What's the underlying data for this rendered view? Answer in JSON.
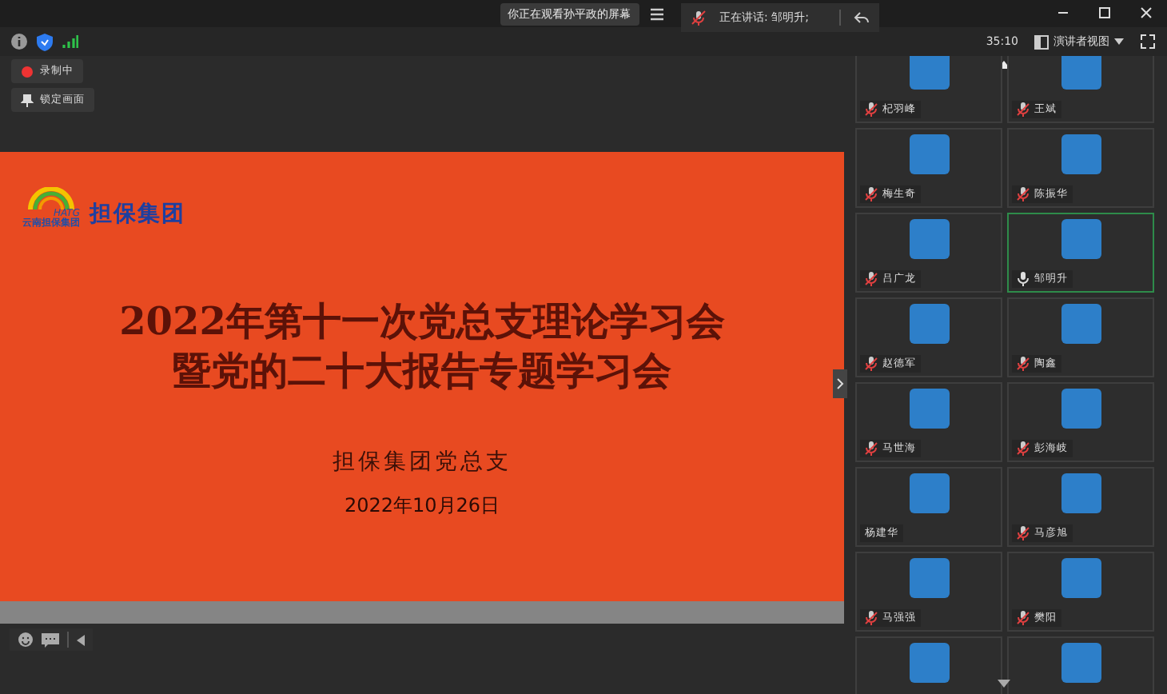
{
  "top_bar": {
    "sharing_notice": "你正在观看孙平政的屏幕",
    "speaking": "正在讲话: 邹明升;"
  },
  "status_bar": {
    "timer": "35:10",
    "view_menu": "演讲者视图"
  },
  "controls": [
    {
      "label": "录制中",
      "kind": "recording"
    },
    {
      "label": "锁定画面",
      "kind": "pin"
    }
  ],
  "slide": {
    "logo_mark": "HATG",
    "logo_small": "云南担保集团",
    "logo_name": "担保集团",
    "title_lines": [
      "2022年第十一次党总支理论学习会",
      "暨党的二十大报告专题学习会"
    ],
    "organizer": "担保集团党总支",
    "date": "2022年10月26日"
  },
  "participants": [
    {
      "name": "杞羽峰",
      "kind": "muted",
      "speaking": false
    },
    {
      "name": "王斌",
      "kind": "muted",
      "speaking": false
    },
    {
      "name": "梅生奇",
      "kind": "muted",
      "speaking": false
    },
    {
      "name": "陈振华",
      "kind": "muted",
      "speaking": false
    },
    {
      "name": "吕广龙",
      "kind": "muted",
      "speaking": false
    },
    {
      "name": "邹明升",
      "kind": "unmuted",
      "speaking": true
    },
    {
      "name": "赵德军",
      "kind": "muted",
      "speaking": false
    },
    {
      "name": "陶鑫",
      "kind": "muted",
      "speaking": false
    },
    {
      "name": "马世海",
      "kind": "muted",
      "speaking": false
    },
    {
      "name": "彭海岐",
      "kind": "muted",
      "speaking": false
    },
    {
      "name": "杨建华",
      "kind": "nomic",
      "speaking": false
    },
    {
      "name": "马彦旭",
      "kind": "muted",
      "speaking": false
    },
    {
      "name": "马强强",
      "kind": "muted",
      "speaking": false
    },
    {
      "name": "樊阳",
      "kind": "muted",
      "speaking": false
    },
    {
      "kind": "nomic",
      "speaking": false
    },
    {
      "kind": "nomic",
      "speaking": false
    }
  ]
}
